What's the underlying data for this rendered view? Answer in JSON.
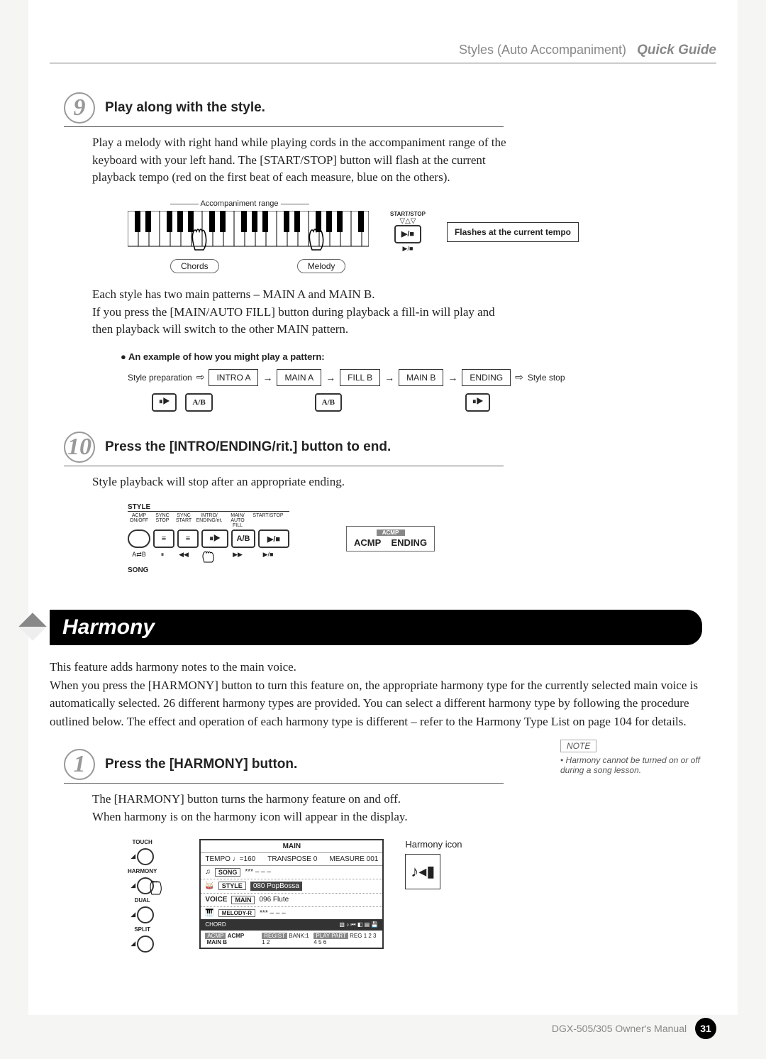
{
  "header": {
    "section": "Styles (Auto Accompaniment)",
    "guide": "Quick Guide"
  },
  "step9": {
    "num": "9",
    "title": "Play along with the style.",
    "p1": "Play a melody with right hand while playing cords in the accompaniment range of the keyboard with your left hand. The [START/STOP] button will flash at the current playback tempo (red on the first beat of each measure, blue on the others).",
    "accomp_label": "Accompaniment range",
    "chords_label": "Chords",
    "melody_label": "Melody",
    "start_stop": "START/STOP",
    "flash_text": "Flashes at the current tempo",
    "play_symbol": "▶/■",
    "p2": "Each style has two main patterns – MAIN A and MAIN B.",
    "p3": "If you press the [MAIN/AUTO FILL] button during playback a fill-in will play and then playback will switch to the other MAIN pattern.",
    "pattern_heading": "● An example of how you might play a pattern:",
    "style_prep": "Style preparation",
    "intro_a": "INTRO A",
    "main_a": "MAIN A",
    "fill_b": "FILL B",
    "main_b": "MAIN B",
    "ending": "ENDING",
    "style_stop": "Style stop",
    "ab": "A/B",
    "sync_icon": "⏸▶"
  },
  "step10": {
    "num": "10",
    "title": "Press the [INTRO/ENDING/rit.] button to end.",
    "p1": "Style playback will stop after an appropriate ending.",
    "panel_style": "STYLE",
    "panel_song": "SONG",
    "btn_labels": [
      "ACMP ON/OFF",
      "SYNC STOP",
      "SYNC START",
      "INTRO/ ENDING/rit.",
      "MAIN/ AUTO FILL",
      "START/STOP"
    ],
    "arepeat": "A⇄B",
    "ab": "A/B",
    "display_acmp": "ACMP",
    "display_ending": "ENDING",
    "display_hdr": "ACMP"
  },
  "harmony": {
    "title": "Harmony",
    "body": "This feature adds harmony notes to the main voice.\nWhen you press the [HARMONY] button to turn this feature on, the appropriate harmony type for the currently selected main voice is automatically selected. 26 different harmony types are provided. You can select a different harmony type by following the procedure outlined below. The effect and operation of each harmony type is different – refer to the Harmony Type List on page 104 for details."
  },
  "step1": {
    "num": "1",
    "title": "Press the [HARMONY] button.",
    "p1": "The [HARMONY] button turns the harmony feature on and off.",
    "p2": "When harmony is on the harmony icon will appear in the display.",
    "note_label": "NOTE",
    "note_text": "• Harmony cannot be turned on or off during a song lesson.",
    "knobs": [
      "TOUCH",
      "HARMONY",
      "DUAL",
      "SPLIT"
    ],
    "lcd": {
      "main": "MAIN",
      "tempo": "TEMPO ♩=160",
      "transpose": "TRANSPOSE 0",
      "measure": "MEASURE 001",
      "song_lbl": "SONG",
      "song_val": "*** – – –",
      "style_lbl": "STYLE",
      "style_val": "080 PopBossa",
      "voice_lbl": "VOICE",
      "main_lbl": "MAIN",
      "main_val": "096 Flute",
      "melr_lbl": "MELODY-R",
      "melr_val": "*** – – –",
      "chord": "CHORD",
      "acmp": "ACMP",
      "mainb": "MAIN B",
      "regist": "REGIST",
      "bank": "BANK:1   1  2",
      "playpart": "PLAY PART",
      "reg": "REG  1 2 3 4 5 6"
    },
    "harmony_icon_label": "Harmony icon"
  },
  "footer": {
    "text": "DGX-505/305  Owner's Manual",
    "page": "31"
  }
}
